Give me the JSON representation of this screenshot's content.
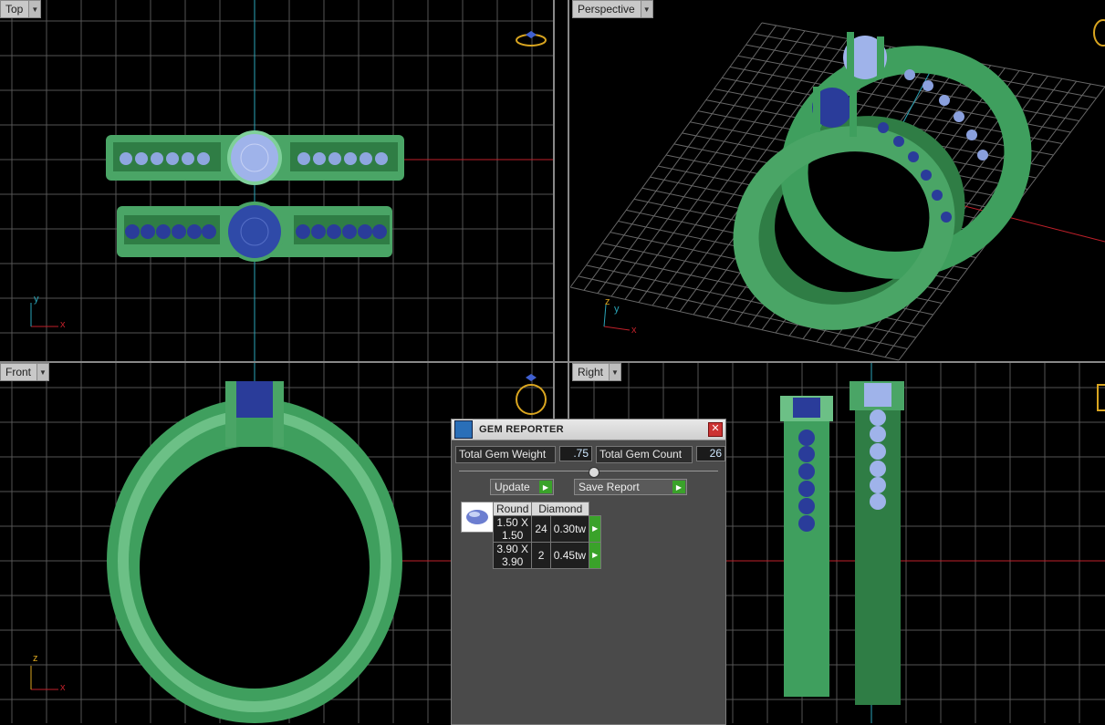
{
  "viewports": {
    "top": {
      "label": "Top"
    },
    "perspective": {
      "label": "Perspective"
    },
    "front": {
      "label": "Front"
    },
    "right": {
      "label": "Right"
    }
  },
  "axes": {
    "x": "x",
    "y": "y",
    "z": "z"
  },
  "gem_reporter": {
    "title": "GEM REPORTER",
    "total_weight_label": "Total Gem Weight",
    "total_weight_value": ".75",
    "total_count_label": "Total Gem Count",
    "total_count_value": "26",
    "update_label": "Update",
    "save_report_label": "Save Report",
    "table": {
      "headers": [
        "Round",
        "Diamond"
      ],
      "rows": [
        {
          "size": "1.50 X 1.50",
          "count": "24",
          "weight": "0.30tw"
        },
        {
          "size": "3.90 X 3.90",
          "count": "2",
          "weight": "0.45tw"
        }
      ]
    }
  },
  "colors": {
    "metal": "#3f9f5e",
    "metal_light": "#7fd09a",
    "gem_light": "#8aa0dd",
    "gem_dark": "#2a3c9a",
    "grid": "#5a5a5a",
    "axis_x": "#c0202a",
    "axis_y": "#2aa5b8",
    "ring_icon": "#d9a520"
  }
}
